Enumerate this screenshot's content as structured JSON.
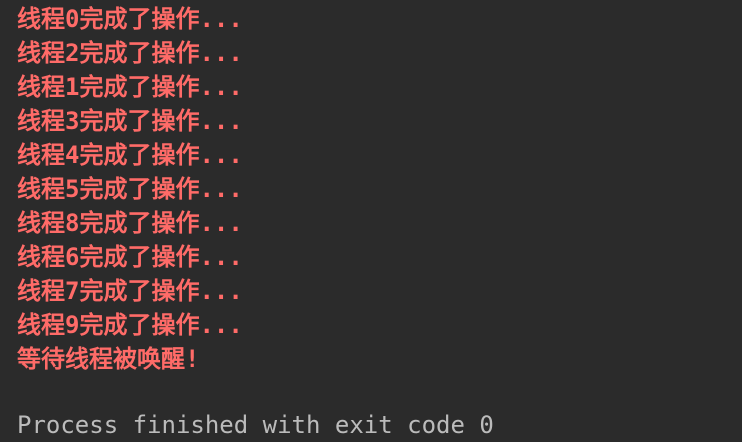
{
  "console": {
    "stderr_lines": [
      "线程0完成了操作...",
      "线程2完成了操作...",
      "线程1完成了操作...",
      "线程3完成了操作...",
      "线程4完成了操作...",
      "线程5完成了操作...",
      "线程8完成了操作...",
      "线程6完成了操作...",
      "线程7完成了操作...",
      "线程9完成了操作...",
      "等待线程被唤醒!"
    ],
    "exit_message": "Process finished with exit code 0",
    "colors": {
      "background": "#2b2b2b",
      "stderr_text": "#ff6b68",
      "stdout_text": "#bbbbbb"
    }
  }
}
